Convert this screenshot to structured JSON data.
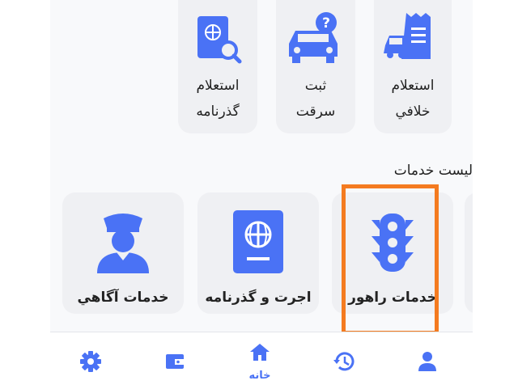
{
  "top_services": [
    {
      "name": "inquiry-violation",
      "line1": "استعلام",
      "line2": "خلافي",
      "icon": "car-receipt-icon"
    },
    {
      "name": "register-theft",
      "line1": "ثبت",
      "line2": "سرقت",
      "icon": "car-question-icon"
    },
    {
      "name": "inquiry-passport",
      "line1": "استعلام",
      "line2": "گذرنامه",
      "icon": "passport-search-icon"
    }
  ],
  "section_title": "لیست خدمات",
  "service_list": [
    {
      "name": "traffic-services",
      "label": "خدمات راهور",
      "icon": "traffic-light-icon"
    },
    {
      "name": "immigration-passport",
      "label": "اجرت و گذرنامه",
      "icon": "passport-icon"
    },
    {
      "name": "agahi-services",
      "label": "خدمات آگاهي",
      "icon": "police-officer-icon"
    }
  ],
  "nav": {
    "home_label": "خانه",
    "items": [
      "profile-icon",
      "history-icon",
      "home-icon",
      "wallet-icon",
      "settings-icon"
    ]
  },
  "colors": {
    "accent": "#4a72f5",
    "highlight": "#f47b20",
    "tile": "#eff0f3"
  }
}
